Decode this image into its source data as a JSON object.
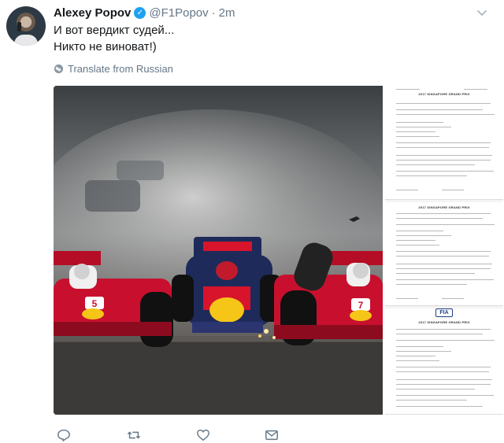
{
  "tweet": {
    "display_name": "Alexey Popov",
    "handle": "@F1Popov",
    "separator": "·",
    "time": "2m",
    "text_lines": [
      "И вот вердикт судей...",
      "Никто не виноват!)"
    ],
    "translate_label": "Translate from Russian"
  },
  "document": {
    "title": "2017 SINGAPORE GRAND PRIX",
    "logo": "FIA"
  },
  "icons": {
    "verified": "verified-badge-icon",
    "caret": "chevron-down-icon",
    "globe": "globe-icon",
    "reply": "reply-icon",
    "retweet": "retweet-icon",
    "like": "heart-icon",
    "message": "envelope-icon"
  },
  "colors": {
    "link_blue": "#1da1f2",
    "muted": "#657786",
    "text": "#14171a",
    "ferrari_red": "#c8102e",
    "redbull_navy": "#1e2a5a"
  }
}
